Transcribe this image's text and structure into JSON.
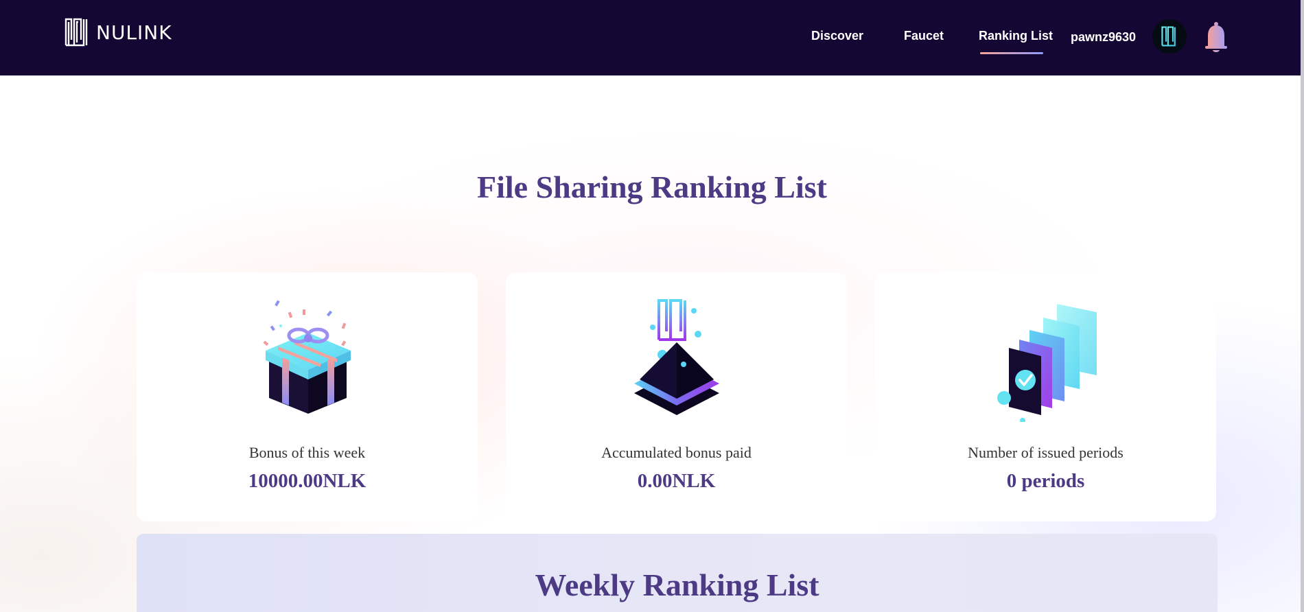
{
  "header": {
    "brand": "NULINK",
    "nav": [
      {
        "label": "Discover"
      },
      {
        "label": "Faucet"
      },
      {
        "label": "Ranking List"
      }
    ],
    "active_nav": "Ranking List",
    "username": "pawnz9630"
  },
  "main": {
    "title": "File Sharing Ranking List",
    "cards": [
      {
        "icon": "gift-box-icon",
        "label": "Bonus of this week",
        "value": "10000.00NLK"
      },
      {
        "icon": "nulink-pyramid-icon",
        "label": "Accumulated bonus paid",
        "value": "0.00NLK"
      },
      {
        "icon": "stacked-documents-check-icon",
        "label": "Number of issued periods",
        "value": "0 periods"
      }
    ],
    "weekly_title": "Weekly Ranking List"
  },
  "colors": {
    "header_bg": "#140733",
    "title": "#4c3a85",
    "accent_gradient_start": "#f6a39c",
    "accent_gradient_end": "#8f9cf7"
  }
}
